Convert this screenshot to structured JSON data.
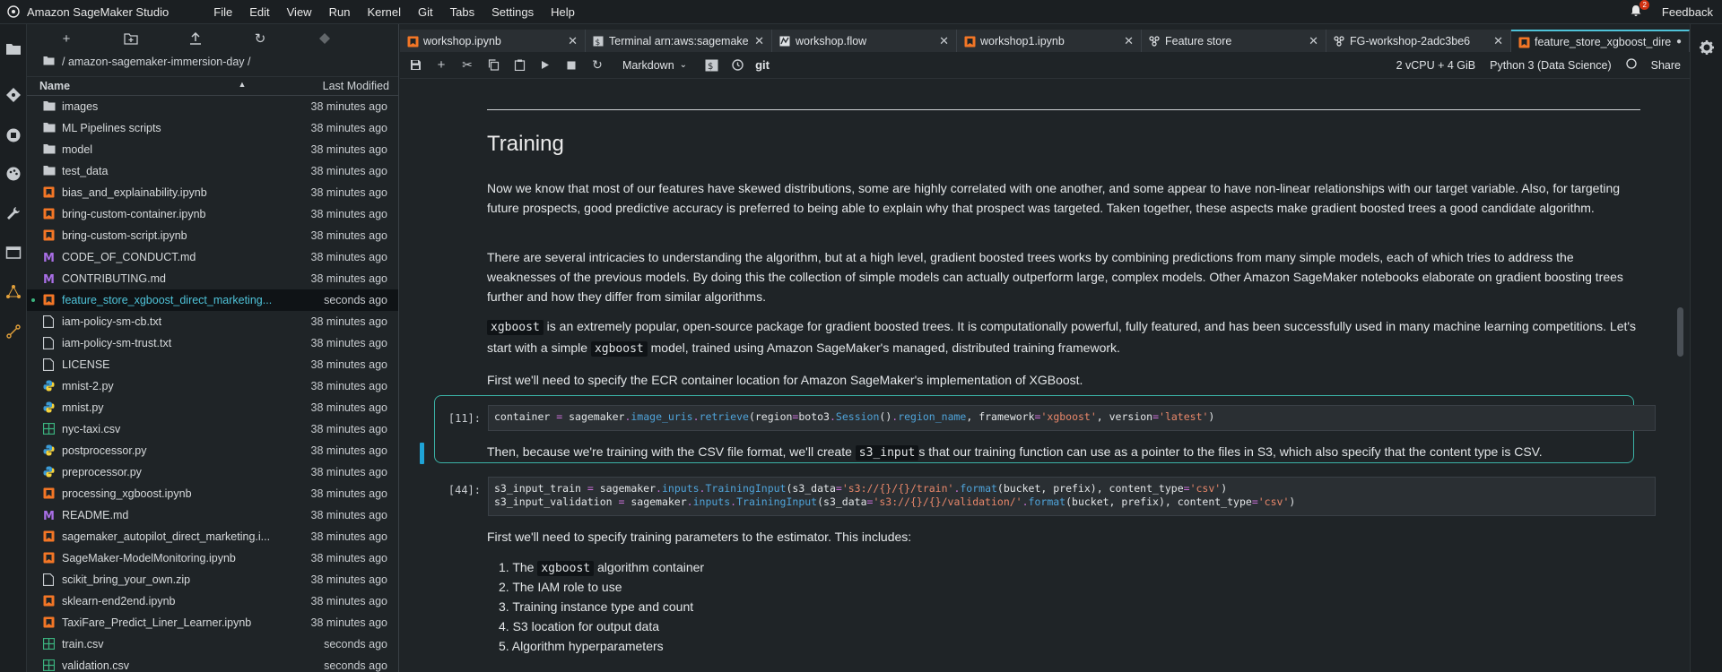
{
  "app": {
    "title": "Amazon SageMaker Studio",
    "menu": [
      "File",
      "Edit",
      "View",
      "Run",
      "Kernel",
      "Git",
      "Tabs",
      "Settings",
      "Help"
    ],
    "notification_count": "2",
    "feedback_label": "Feedback"
  },
  "filebrowser": {
    "breadcrumb": "/ amazon-sagemaker-immersion-day /",
    "col_name": "Name",
    "col_modified": "Last Modified",
    "files": [
      {
        "name": "images",
        "modified": "38 minutes ago",
        "icon": "folder-icon"
      },
      {
        "name": "ML Pipelines scripts",
        "modified": "38 minutes ago",
        "icon": "folder-icon"
      },
      {
        "name": "model",
        "modified": "38 minutes ago",
        "icon": "folder-icon"
      },
      {
        "name": "test_data",
        "modified": "38 minutes ago",
        "icon": "folder-icon"
      },
      {
        "name": "bias_and_explainability.ipynb",
        "modified": "38 minutes ago",
        "icon": "notebook-icon"
      },
      {
        "name": "bring-custom-container.ipynb",
        "modified": "38 minutes ago",
        "icon": "notebook-icon"
      },
      {
        "name": "bring-custom-script.ipynb",
        "modified": "38 minutes ago",
        "icon": "notebook-icon"
      },
      {
        "name": "CODE_OF_CONDUCT.md",
        "modified": "38 minutes ago",
        "icon": "markdown-icon"
      },
      {
        "name": "CONTRIBUTING.md",
        "modified": "38 minutes ago",
        "icon": "markdown-icon"
      },
      {
        "name": "feature_store_xgboost_direct_marketing...",
        "modified": "seconds ago",
        "icon": "notebook-icon",
        "selected": true
      },
      {
        "name": "iam-policy-sm-cb.txt",
        "modified": "38 minutes ago",
        "icon": "file-icon"
      },
      {
        "name": "iam-policy-sm-trust.txt",
        "modified": "38 minutes ago",
        "icon": "file-icon"
      },
      {
        "name": "LICENSE",
        "modified": "38 minutes ago",
        "icon": "file-icon"
      },
      {
        "name": "mnist-2.py",
        "modified": "38 minutes ago",
        "icon": "python-icon"
      },
      {
        "name": "mnist.py",
        "modified": "38 minutes ago",
        "icon": "python-icon"
      },
      {
        "name": "nyc-taxi.csv",
        "modified": "38 minutes ago",
        "icon": "csv-icon"
      },
      {
        "name": "postprocessor.py",
        "modified": "38 minutes ago",
        "icon": "python-icon"
      },
      {
        "name": "preprocessor.py",
        "modified": "38 minutes ago",
        "icon": "python-icon"
      },
      {
        "name": "processing_xgboost.ipynb",
        "modified": "38 minutes ago",
        "icon": "notebook-icon"
      },
      {
        "name": "README.md",
        "modified": "38 minutes ago",
        "icon": "markdown-icon"
      },
      {
        "name": "sagemaker_autopilot_direct_marketing.i...",
        "modified": "38 minutes ago",
        "icon": "notebook-icon"
      },
      {
        "name": "SageMaker-ModelMonitoring.ipynb",
        "modified": "38 minutes ago",
        "icon": "notebook-icon"
      },
      {
        "name": "scikit_bring_your_own.zip",
        "modified": "38 minutes ago",
        "icon": "file-icon"
      },
      {
        "name": "sklearn-end2end.ipynb",
        "modified": "38 minutes ago",
        "icon": "notebook-icon"
      },
      {
        "name": "TaxiFare_Predict_Liner_Learner.ipynb",
        "modified": "38 minutes ago",
        "icon": "notebook-icon"
      },
      {
        "name": "train.csv",
        "modified": "seconds ago",
        "icon": "csv-icon"
      },
      {
        "name": "validation.csv",
        "modified": "seconds ago",
        "icon": "csv-icon"
      }
    ]
  },
  "tabs": [
    {
      "label": "workshop.ipynb",
      "icon": "notebook-icon"
    },
    {
      "label": "Terminal arn:aws:sagemake",
      "icon": "terminal-icon"
    },
    {
      "label": "workshop.flow",
      "icon": "flow-icon"
    },
    {
      "label": "workshop1.ipynb",
      "icon": "notebook-icon"
    },
    {
      "label": "Feature store",
      "icon": "feature-store-icon"
    },
    {
      "label": "FG-workshop-2adc3be6",
      "icon": "feature-group-icon"
    },
    {
      "label": "feature_store_xgboost_dire",
      "icon": "notebook-icon",
      "active": true
    }
  ],
  "nbtoolbar": {
    "cell_type": "Markdown",
    "git_label": "git",
    "instance": "2 vCPU + 4 GiB",
    "kernel": "Python 3 (Data Science)",
    "share_label": "Share"
  },
  "notebook": {
    "heading": "Training",
    "p1": "Now we know that most of our features have skewed distributions, some are highly correlated with one another, and some appear to have non-linear relationships with our target variable. Also, for targeting future prospects, good predictive accuracy is preferred to being able to explain why that prospect was targeted. Taken together, these aspects make gradient boosted trees a good candidate algorithm.",
    "p2": "There are several intricacies to understanding the algorithm, but at a high level, gradient boosted trees works by combining predictions from many simple models, each of which tries to address the weaknesses of the previous models. By doing this the collection of simple models can actually outperform large, complex models. Other Amazon SageMaker notebooks elaborate on gradient boosting trees further and how they differ from similar algorithms.",
    "p3_code": "xgboost",
    "p3_text": " is an extremely popular, open-source package for gradient boosted trees. It is computationally powerful, fully featured, and has been successfully used in many machine learning competitions. Let's start with a simple ",
    "p3_code2": "xgboost",
    "p3_text2": " model, trained using Amazon SageMaker's managed, distributed training framework.",
    "p4": "First we'll need to specify the ECR container location for Amazon SageMaker's implementation of XGBoost.",
    "cell1_prompt": "[11]:",
    "p5_a": "Then, because we're training with the CSV file format, we'll create ",
    "p5_code": "s3_input",
    "p5_b": "s that our training function can use as a pointer to the files in S3, which also specify that the content type is CSV.",
    "cell2_prompt": "[44]:",
    "p6": "First we'll need to specify training parameters to the estimator. This includes:",
    "list": {
      "i1_a": "1. The ",
      "i1_code": "xgboost",
      "i1_b": " algorithm container",
      "i2": "2. The IAM role to use",
      "i3": "3. Training instance type and count",
      "i4": "4. S3 location for output data",
      "i5": "5. Algorithm hyperparameters"
    }
  },
  "colors": {
    "accent": "#4fc3d9",
    "active_frame": "#3bb2a6",
    "notebook_icon": "#f37626",
    "markdown_icon": "#a86ee5",
    "python_icon": "#3b9bd6",
    "csv_icon": "#3bb27e"
  }
}
